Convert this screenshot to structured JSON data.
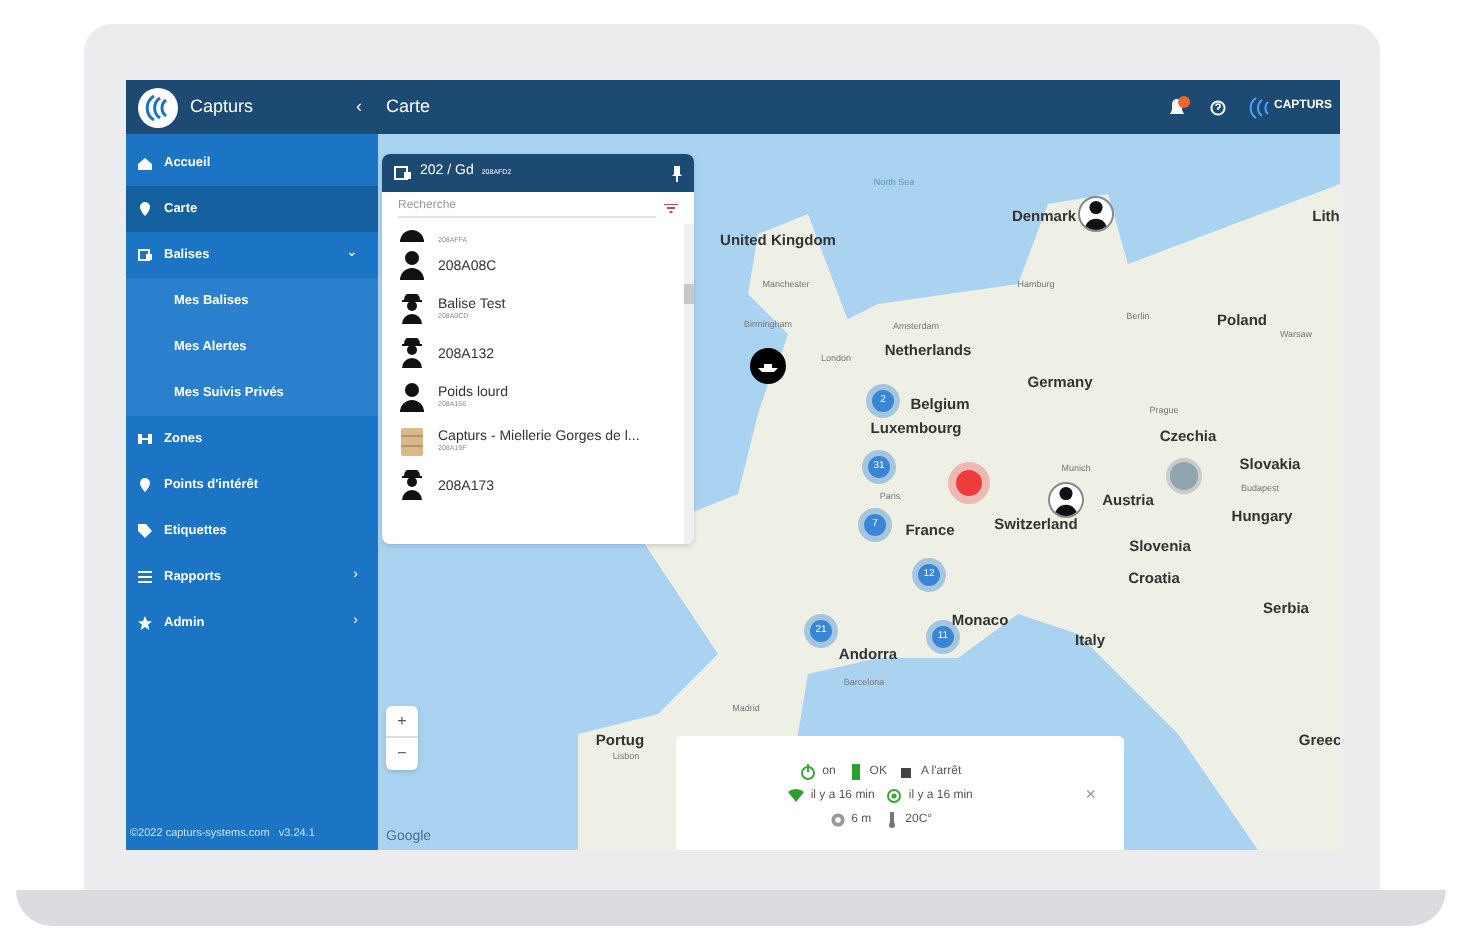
{
  "header": {
    "app_name": "Capturs",
    "collapse": "‹",
    "title": "Carte",
    "brand": "CAPTURS"
  },
  "sidebar": {
    "items": [
      {
        "label": "Accueil",
        "selected": false
      },
      {
        "label": "Carte",
        "selected": true
      },
      {
        "label": "Balises",
        "selected": false,
        "expanded": true,
        "chevron": "⌄",
        "children": [
          {
            "label": "Mes Balises",
            "selected": false
          },
          {
            "label": "Mes Alertes",
            "selected": false
          },
          {
            "label": "Mes Suivis Privés",
            "selected": false
          }
        ]
      },
      {
        "label": "Zones",
        "selected": false
      },
      {
        "label": "Points d'intérêt",
        "selected": false
      },
      {
        "label": "Etiquettes",
        "selected": false
      },
      {
        "label": "Rapports",
        "selected": false,
        "chevron": "›"
      },
      {
        "label": "Admin",
        "selected": false,
        "chevron": "›"
      }
    ],
    "footer": "©2022 capturs-systems.com   v3.24.1"
  },
  "device_panel": {
    "title": "202 / Gd",
    "code": "208AFD2",
    "search": {
      "placeholder": "Recherche"
    },
    "items": [
      {
        "kind": "person",
        "code": "208AFFA"
      },
      {
        "kind": "person",
        "name": "208A08C"
      },
      {
        "kind": "worker",
        "name": "Balise Test",
        "code": "208A0CD"
      },
      {
        "kind": "worker",
        "name": "208A132"
      },
      {
        "kind": "person",
        "name": "Poids lourd",
        "code": "208A156"
      },
      {
        "kind": "box",
        "name": "Capturs - Miellerie Gorges de l...",
        "code": "208A19F"
      },
      {
        "kind": "worker",
        "name": "208A173"
      }
    ]
  },
  "map": {
    "labels": [
      {
        "kind": "region",
        "text": "North Sea"
      },
      {
        "kind": "country",
        "text": "United Kingdom"
      },
      {
        "kind": "country",
        "text": "Denmark"
      },
      {
        "kind": "country",
        "text": "Lith"
      },
      {
        "kind": "city",
        "text": "Manchester"
      },
      {
        "kind": "city",
        "text": "Birmingham"
      },
      {
        "kind": "city",
        "text": "London"
      },
      {
        "kind": "city",
        "text": "Amsterdam"
      },
      {
        "kind": "city",
        "text": "Hamburg"
      },
      {
        "kind": "city",
        "text": "Berlin"
      },
      {
        "kind": "country",
        "text": "Netherlands"
      },
      {
        "kind": "country",
        "text": "Germany"
      },
      {
        "kind": "country",
        "text": "Poland"
      },
      {
        "kind": "city",
        "text": "Warsaw"
      },
      {
        "kind": "country",
        "text": "Belgium"
      },
      {
        "kind": "country",
        "text": "Luxembourg"
      },
      {
        "kind": "city",
        "text": "Prague"
      },
      {
        "kind": "country",
        "text": "Czechia"
      },
      {
        "kind": "country",
        "text": "Slovakia"
      },
      {
        "kind": "city",
        "text": "Paris"
      },
      {
        "kind": "city",
        "text": "Munich"
      },
      {
        "kind": "city",
        "text": "Budapest"
      },
      {
        "kind": "country",
        "text": "Austria"
      },
      {
        "kind": "country",
        "text": "Hungary"
      },
      {
        "kind": "country",
        "text": "France"
      },
      {
        "kind": "country",
        "text": "Switzerland"
      },
      {
        "kind": "country",
        "text": "Slovenia"
      },
      {
        "kind": "country",
        "text": "Croatia"
      },
      {
        "kind": "country",
        "text": "Serbia"
      },
      {
        "kind": "country",
        "text": "Monaco"
      },
      {
        "kind": "country",
        "text": "Italy"
      },
      {
        "kind": "country",
        "text": "Andorra"
      },
      {
        "kind": "city",
        "text": "Barcelona"
      },
      {
        "kind": "city",
        "text": "Madrid"
      },
      {
        "kind": "country",
        "text": "Portug"
      },
      {
        "kind": "city",
        "text": "Lisbon"
      },
      {
        "kind": "country",
        "text": "Greec"
      }
    ],
    "markers": [
      {
        "kind": "vessel"
      },
      {
        "kind": "person"
      },
      {
        "kind": "cluster",
        "count": "2"
      },
      {
        "kind": "cluster",
        "count": "31"
      },
      {
        "kind": "cluster",
        "count": "7"
      },
      {
        "kind": "cluster",
        "count": "12"
      },
      {
        "kind": "cluster",
        "count": "21"
      },
      {
        "kind": "cluster",
        "count": "11"
      },
      {
        "kind": "alert"
      },
      {
        "kind": "person"
      },
      {
        "kind": "photo"
      }
    ],
    "zoom_in": "+",
    "zoom_out": "−",
    "attribution": "Google"
  },
  "status_popup": {
    "rows": [
      [
        "on",
        "OK",
        "A l'arrêt"
      ],
      [
        "il y a 16 min",
        "il y a 16 min"
      ],
      [
        "6 m",
        "20C°"
      ]
    ],
    "close": "×"
  }
}
